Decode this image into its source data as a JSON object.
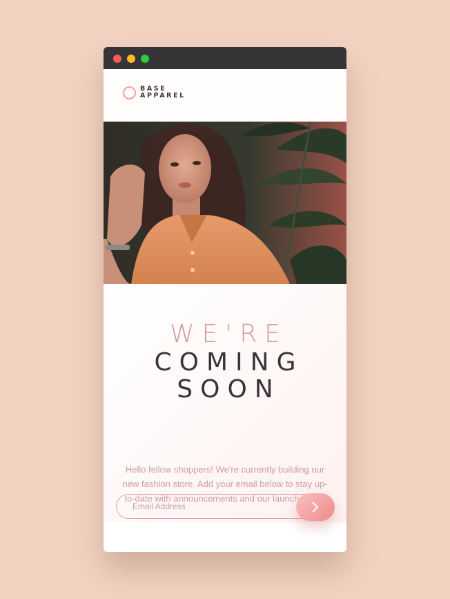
{
  "window": {
    "controls": [
      "close",
      "minimize",
      "maximize"
    ]
  },
  "logo": {
    "line1": "BASE",
    "line2": "APPAREL"
  },
  "hero": {
    "icon": "hero-photo"
  },
  "headline": {
    "line1": "WE'RE",
    "line2": "COMING",
    "line3": "SOON"
  },
  "description": "Hello fellow shoppers! We're currently building our new fashion store. Add your email below to stay up-to-date with announcements and our launch deals.",
  "form": {
    "email_placeholder": "Email Address",
    "email_value": "",
    "submit_icon": "arrow-right-icon"
  },
  "colors": {
    "background": "#f2d3c1",
    "accent": "#ee8b8b",
    "text_light": "#cf9c9c",
    "text_dark": "#3a3436"
  }
}
